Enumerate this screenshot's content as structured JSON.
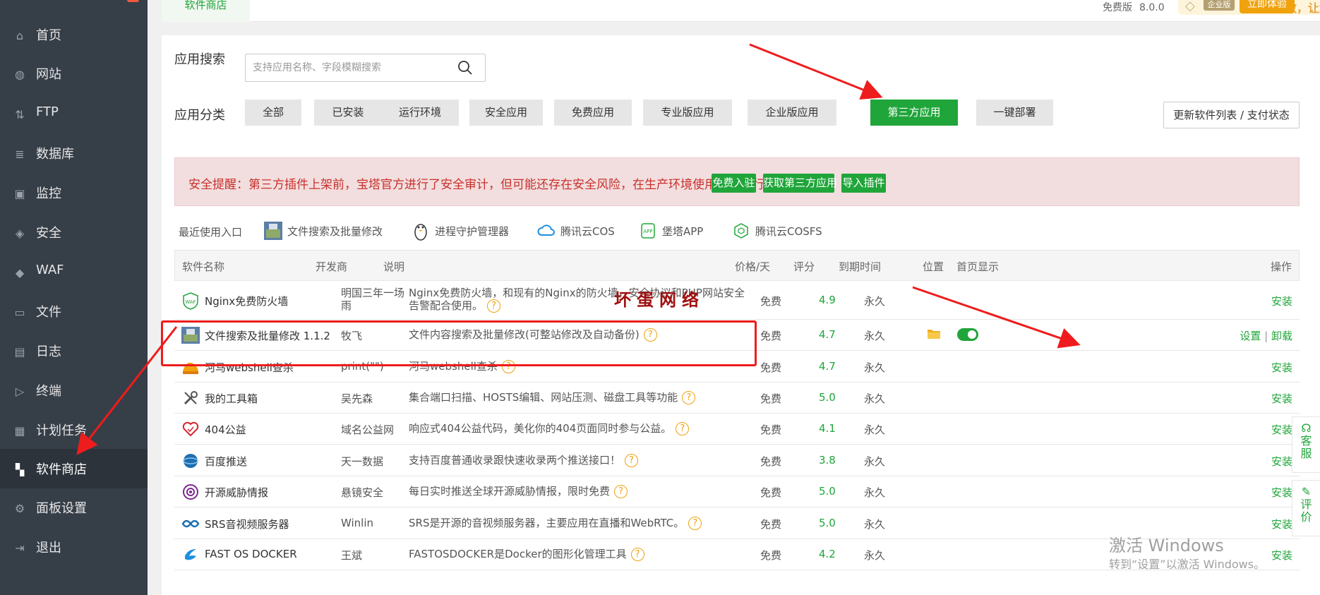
{
  "sidebar": {
    "items": [
      {
        "label": "首页",
        "icon": "home-icon",
        "glyph": "⌂"
      },
      {
        "label": "网站",
        "icon": "globe-icon",
        "glyph": "◍"
      },
      {
        "label": "FTP",
        "icon": "ftp-icon",
        "glyph": "⇅"
      },
      {
        "label": "数据库",
        "icon": "database-icon",
        "glyph": "≣"
      },
      {
        "label": "监控",
        "icon": "monitor-icon",
        "glyph": "▣"
      },
      {
        "label": "安全",
        "icon": "shield-icon",
        "glyph": "◈"
      },
      {
        "label": "WAF",
        "icon": "waf-shield-icon",
        "glyph": "◆"
      },
      {
        "label": "文件",
        "icon": "folder-icon",
        "glyph": "▭"
      },
      {
        "label": "日志",
        "icon": "log-icon",
        "glyph": "▤"
      },
      {
        "label": "终端",
        "icon": "terminal-icon",
        "glyph": "▷"
      },
      {
        "label": "计划任务",
        "icon": "calendar-icon",
        "glyph": "▦"
      },
      {
        "label": "软件商店",
        "icon": "grid-icon",
        "glyph": "▚"
      },
      {
        "label": "面板设置",
        "icon": "gear-icon",
        "glyph": "⚙"
      },
      {
        "label": "退出",
        "icon": "logout-icon",
        "glyph": "⇥"
      }
    ],
    "active_index": 11
  },
  "header": {
    "tab_label": "软件商店",
    "edition": "免费版",
    "version": "8.0.0",
    "promo_tag": "企业版",
    "promo_text": "安全、高效，让您更安心！",
    "try_button": "立即体验"
  },
  "search": {
    "label": "应用搜索",
    "placeholder": "支持应用名称、字段模糊搜索"
  },
  "categories": {
    "label": "应用分类",
    "items": [
      "全部",
      "已安装",
      "运行环境",
      "安全应用",
      "免费应用",
      "专业版应用",
      "企业版应用",
      "第三方应用",
      "一键部署"
    ],
    "active_index": 7,
    "update_button": "更新软件列表 / 支付状态"
  },
  "alert": {
    "message": "安全提醒：第三方插件上架前，宝塔官方进行了安全审计，但可能还存在安全风险，在生产环境使用前请自行甄别",
    "buttons": [
      "免费入驻",
      "获取第三方应用",
      "导入插件"
    ]
  },
  "recent": {
    "label": "最近使用入口",
    "items": [
      "文件搜索及批量修改",
      "进程守护管理器",
      "腾讯云COS",
      "堡塔APP",
      "腾讯云COSFS"
    ]
  },
  "table": {
    "headers": [
      "软件名称",
      "开发商",
      "说明",
      "价格/天",
      "评分",
      "到期时间",
      "位置",
      "首页显示",
      "操作"
    ],
    "rows": [
      {
        "name": "Nginx免费防火墙",
        "dev": "明国三年一场雨",
        "desc": "Nginx免费防火墙，和现有的Nginx的防火墙，安全协议和PHP网站安全告警配合使用。",
        "price": "免费",
        "score": "4.9",
        "expire": "永久",
        "op": "安装"
      },
      {
        "name": "文件搜索及批量修改 1.1.2",
        "dev": "牧飞",
        "desc": "文件内容搜索及批量修改(可整站修改及自动备份)",
        "price": "免费",
        "score": "4.7",
        "expire": "永久",
        "op_set": "设置",
        "op_sep": "|",
        "op_uninstall": "卸载"
      },
      {
        "name": "河马webshell查杀",
        "dev": "print(\"\")",
        "desc": "河马webshell查杀",
        "price": "免费",
        "score": "4.7",
        "expire": "永久",
        "op": "安装"
      },
      {
        "name": "我的工具箱",
        "dev": "吴先森",
        "desc": "集合端口扫描、HOSTS编辑、网站压测、磁盘工具等功能",
        "price": "免费",
        "score": "5.0",
        "expire": "永久",
        "op": "安装"
      },
      {
        "name": "404公益",
        "dev": "域名公益网",
        "desc": "响应式404公益代码，美化你的404页面同时参与公益。",
        "price": "免费",
        "score": "4.1",
        "expire": "永久",
        "op": "安装"
      },
      {
        "name": "百度推送",
        "dev": "天一数据",
        "desc": "支持百度普通收录跟快速收录两个推送接口！",
        "price": "免费",
        "score": "3.8",
        "expire": "永久",
        "op": "安装"
      },
      {
        "name": "开源威胁情报",
        "dev": "悬镜安全",
        "desc": "每日实时推送全球开源威胁情报，限时免费",
        "price": "免费",
        "score": "5.0",
        "expire": "永久",
        "op": "安装"
      },
      {
        "name": "SRS音视频服务器",
        "dev": "Winlin",
        "desc": "SRS是开源的音视频服务器，主要应用在直播和WebRTC。",
        "price": "免费",
        "score": "5.0",
        "expire": "永久",
        "op": "安装"
      },
      {
        "name": "FAST OS DOCKER",
        "dev": "王斌",
        "desc": "FASTOSDOCKER是Docker的图形化管理工具",
        "price": "免费",
        "score": "4.2",
        "expire": "永久",
        "op": "安装"
      }
    ]
  },
  "overlay": {
    "watermark": "坏蛋网络",
    "windows_title": "激活 Windows",
    "windows_sub": "转到“设置”以激活 Windows。"
  },
  "float": {
    "service": [
      "客",
      "服"
    ],
    "review": [
      "评",
      "价"
    ]
  },
  "colors": {
    "sidebar_bg": "#363e48",
    "accent": "#20a53a",
    "alert_text": "#c9302c",
    "alert_bg": "#f2dede",
    "warning": "#f0a20c",
    "annotation": "#ee1c1c"
  }
}
